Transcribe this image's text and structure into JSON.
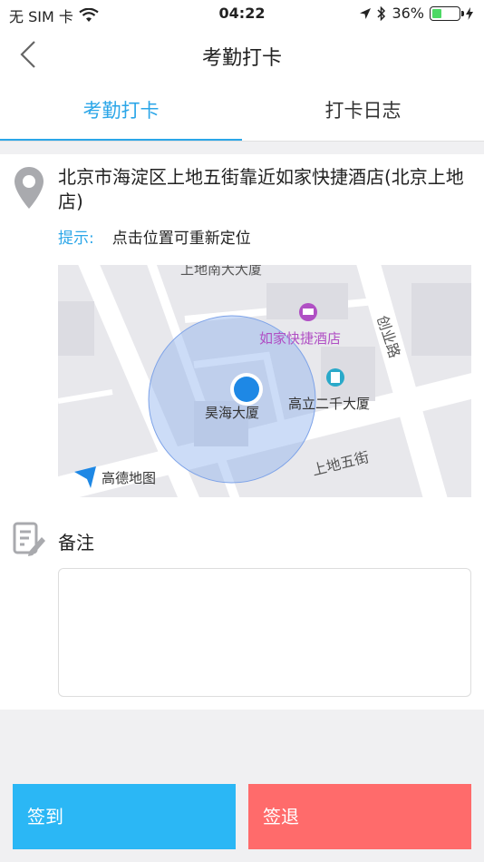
{
  "status": {
    "carrier": "无 SIM 卡",
    "time": "04:22",
    "battery": "36%",
    "battery_level": 0.36
  },
  "nav": {
    "title": "考勤打卡"
  },
  "tabs": [
    {
      "label": "考勤打卡",
      "active": true
    },
    {
      "label": "打卡日志",
      "active": false
    }
  ],
  "location": {
    "address": "北京市海淀区上地五街靠近如家快捷酒店(北京上地店)",
    "tip_label": "提示:",
    "tip_message": "点击位置可重新定位"
  },
  "map": {
    "labels": {
      "top_building": "上地南大大厦",
      "hotel": "如家快捷酒店",
      "road_chuangye": "创业路",
      "haohai": "昊海大厦",
      "gaoli": "高立二千大厦",
      "road_shangdi5": "上地五街",
      "brand": "高德地图"
    },
    "colors": {
      "accuracy": "#8fb2ee",
      "pin": "#1e88e5",
      "hotel": "#b04fc4",
      "poi": "#2aa9c9"
    }
  },
  "remark": {
    "label": "备注",
    "placeholder": ""
  },
  "actions": {
    "sign_in": "签到",
    "sign_out": "签退"
  },
  "colors": {
    "accent": "#2ba6e8",
    "sign_in": "#2bb7f5",
    "sign_out": "#ff6b6b"
  }
}
